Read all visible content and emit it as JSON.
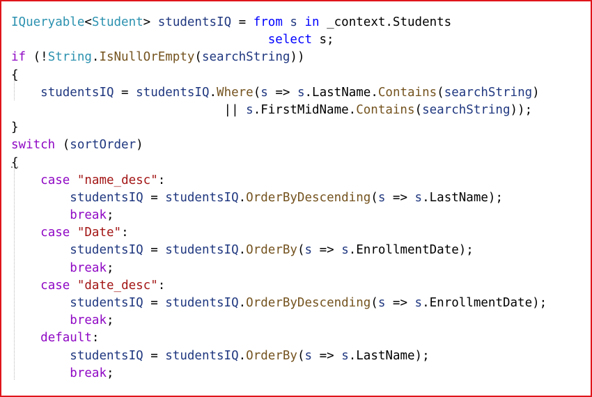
{
  "accent_border_color": "#e0151b",
  "code_lines": [
    {
      "indent": 0,
      "tokens": [
        {
          "t": "IQueryable",
          "c": "type"
        },
        {
          "t": "<",
          "c": "plain"
        },
        {
          "t": "Student",
          "c": "type"
        },
        {
          "t": "> ",
          "c": "plain"
        },
        {
          "t": "studentsIQ",
          "c": "var"
        },
        {
          "t": " = ",
          "c": "plain"
        },
        {
          "t": "from",
          "c": "kw"
        },
        {
          "t": " s ",
          "c": "var"
        },
        {
          "t": "in",
          "c": "kw"
        },
        {
          "t": " _context.Students",
          "c": "plain"
        }
      ]
    },
    {
      "indent": 0,
      "tokens": [
        {
          "t": "                                   ",
          "c": "plain"
        },
        {
          "t": "select",
          "c": "kw"
        },
        {
          "t": " s;",
          "c": "plain"
        }
      ]
    },
    {
      "indent": 0,
      "tokens": [
        {
          "t": "if",
          "c": "ctl"
        },
        {
          "t": " (!",
          "c": "plain"
        },
        {
          "t": "String",
          "c": "type"
        },
        {
          "t": ".",
          "c": "plain"
        },
        {
          "t": "IsNullOrEmpty",
          "c": "method"
        },
        {
          "t": "(",
          "c": "plain"
        },
        {
          "t": "searchString",
          "c": "var"
        },
        {
          "t": "))",
          "c": "plain"
        }
      ]
    },
    {
      "indent": 0,
      "tokens": [
        {
          "t": "{",
          "c": "plain"
        }
      ]
    },
    {
      "indent": 0,
      "tokens": [
        {
          "t": "    ",
          "c": "plain"
        },
        {
          "t": "studentsIQ",
          "c": "var"
        },
        {
          "t": " = ",
          "c": "plain"
        },
        {
          "t": "studentsIQ",
          "c": "var"
        },
        {
          "t": ".",
          "c": "plain"
        },
        {
          "t": "Where",
          "c": "method"
        },
        {
          "t": "(",
          "c": "plain"
        },
        {
          "t": "s",
          "c": "var"
        },
        {
          "t": " => ",
          "c": "plain"
        },
        {
          "t": "s",
          "c": "var"
        },
        {
          "t": ".LastName.",
          "c": "plain"
        },
        {
          "t": "Contains",
          "c": "method"
        },
        {
          "t": "(",
          "c": "plain"
        },
        {
          "t": "searchString",
          "c": "var"
        },
        {
          "t": ")",
          "c": "plain"
        }
      ]
    },
    {
      "indent": 0,
      "tokens": [
        {
          "t": "                             || ",
          "c": "plain"
        },
        {
          "t": "s",
          "c": "var"
        },
        {
          "t": ".FirstMidName.",
          "c": "plain"
        },
        {
          "t": "Contains",
          "c": "method"
        },
        {
          "t": "(",
          "c": "plain"
        },
        {
          "t": "searchString",
          "c": "var"
        },
        {
          "t": "));",
          "c": "plain"
        }
      ]
    },
    {
      "indent": 0,
      "tokens": [
        {
          "t": "}",
          "c": "plain"
        }
      ]
    },
    {
      "indent": 0,
      "tokens": [
        {
          "t": "switch",
          "c": "ctl"
        },
        {
          "t": " (",
          "c": "plain"
        },
        {
          "t": "sortOrder",
          "c": "var"
        },
        {
          "t": ")",
          "c": "plain"
        }
      ]
    },
    {
      "indent": 0,
      "tokens": [
        {
          "t": "{",
          "c": "plain",
          "squiggle": true
        }
      ]
    },
    {
      "indent": 0,
      "tokens": [
        {
          "t": "    ",
          "c": "plain"
        },
        {
          "t": "case",
          "c": "ctl"
        },
        {
          "t": " ",
          "c": "plain"
        },
        {
          "t": "\"name_desc\"",
          "c": "str"
        },
        {
          "t": ":",
          "c": "plain"
        }
      ]
    },
    {
      "indent": 0,
      "tokens": [
        {
          "t": "        ",
          "c": "plain"
        },
        {
          "t": "studentsIQ",
          "c": "var"
        },
        {
          "t": " = ",
          "c": "plain"
        },
        {
          "t": "studentsIQ",
          "c": "var"
        },
        {
          "t": ".",
          "c": "plain"
        },
        {
          "t": "OrderByDescending",
          "c": "method"
        },
        {
          "t": "(",
          "c": "plain"
        },
        {
          "t": "s",
          "c": "var"
        },
        {
          "t": " => ",
          "c": "plain"
        },
        {
          "t": "s",
          "c": "var"
        },
        {
          "t": ".LastName);",
          "c": "plain"
        }
      ]
    },
    {
      "indent": 0,
      "tokens": [
        {
          "t": "        ",
          "c": "plain"
        },
        {
          "t": "break",
          "c": "ctl"
        },
        {
          "t": ";",
          "c": "plain"
        }
      ]
    },
    {
      "indent": 0,
      "tokens": [
        {
          "t": "    ",
          "c": "plain"
        },
        {
          "t": "case",
          "c": "ctl"
        },
        {
          "t": " ",
          "c": "plain"
        },
        {
          "t": "\"Date\"",
          "c": "str"
        },
        {
          "t": ":",
          "c": "plain"
        }
      ]
    },
    {
      "indent": 0,
      "tokens": [
        {
          "t": "        ",
          "c": "plain"
        },
        {
          "t": "studentsIQ",
          "c": "var"
        },
        {
          "t": " = ",
          "c": "plain"
        },
        {
          "t": "studentsIQ",
          "c": "var"
        },
        {
          "t": ".",
          "c": "plain"
        },
        {
          "t": "OrderBy",
          "c": "method"
        },
        {
          "t": "(",
          "c": "plain"
        },
        {
          "t": "s",
          "c": "var"
        },
        {
          "t": " => ",
          "c": "plain"
        },
        {
          "t": "s",
          "c": "var"
        },
        {
          "t": ".EnrollmentDate);",
          "c": "plain"
        }
      ]
    },
    {
      "indent": 0,
      "tokens": [
        {
          "t": "        ",
          "c": "plain"
        },
        {
          "t": "break",
          "c": "ctl"
        },
        {
          "t": ";",
          "c": "plain"
        }
      ]
    },
    {
      "indent": 0,
      "tokens": [
        {
          "t": "    ",
          "c": "plain"
        },
        {
          "t": "case",
          "c": "ctl"
        },
        {
          "t": " ",
          "c": "plain"
        },
        {
          "t": "\"date_desc\"",
          "c": "str"
        },
        {
          "t": ":",
          "c": "plain"
        }
      ]
    },
    {
      "indent": 0,
      "tokens": [
        {
          "t": "        ",
          "c": "plain"
        },
        {
          "t": "studentsIQ",
          "c": "var"
        },
        {
          "t": " = ",
          "c": "plain"
        },
        {
          "t": "studentsIQ",
          "c": "var"
        },
        {
          "t": ".",
          "c": "plain"
        },
        {
          "t": "OrderByDescending",
          "c": "method"
        },
        {
          "t": "(",
          "c": "plain"
        },
        {
          "t": "s",
          "c": "var"
        },
        {
          "t": " => ",
          "c": "plain"
        },
        {
          "t": "s",
          "c": "var"
        },
        {
          "t": ".EnrollmentDate);",
          "c": "plain"
        }
      ]
    },
    {
      "indent": 0,
      "tokens": [
        {
          "t": "        ",
          "c": "plain"
        },
        {
          "t": "break",
          "c": "ctl"
        },
        {
          "t": ";",
          "c": "plain"
        }
      ]
    },
    {
      "indent": 0,
      "tokens": [
        {
          "t": "    ",
          "c": "plain"
        },
        {
          "t": "default",
          "c": "ctl"
        },
        {
          "t": ":",
          "c": "plain"
        }
      ]
    },
    {
      "indent": 0,
      "tokens": [
        {
          "t": "        ",
          "c": "plain"
        },
        {
          "t": "studentsIQ",
          "c": "var"
        },
        {
          "t": " = ",
          "c": "plain"
        },
        {
          "t": "studentsIQ",
          "c": "var"
        },
        {
          "t": ".",
          "c": "plain"
        },
        {
          "t": "OrderBy",
          "c": "method"
        },
        {
          "t": "(",
          "c": "plain"
        },
        {
          "t": "s",
          "c": "var"
        },
        {
          "t": " => ",
          "c": "plain"
        },
        {
          "t": "s",
          "c": "var"
        },
        {
          "t": ".LastName);",
          "c": "plain"
        }
      ]
    },
    {
      "indent": 0,
      "tokens": [
        {
          "t": "        ",
          "c": "plain"
        },
        {
          "t": "break",
          "c": "ctl"
        },
        {
          "t": ";",
          "c": "plain"
        }
      ]
    }
  ]
}
